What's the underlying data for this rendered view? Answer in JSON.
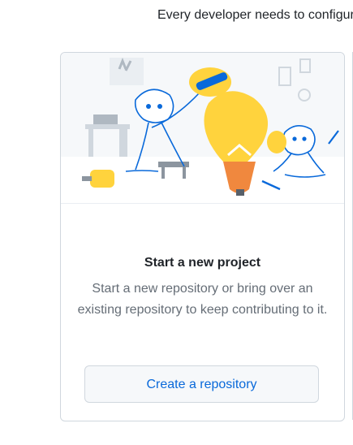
{
  "intro": {
    "text": "Every developer needs to configure"
  },
  "card": {
    "title": "Start a new project",
    "description": "Start a new repository or bring over an existing repository to keep contributing to it.",
    "button_label": "Create a repository",
    "illustration": "octocats-building-lightbulb-illustration"
  },
  "colors": {
    "accent_link": "#0969da",
    "muted_text": "#656d76",
    "border": "#d0d7de",
    "illustration_yellow": "#ffd33d",
    "illustration_blue": "#0969da",
    "illustration_orange": "#f0883e"
  }
}
